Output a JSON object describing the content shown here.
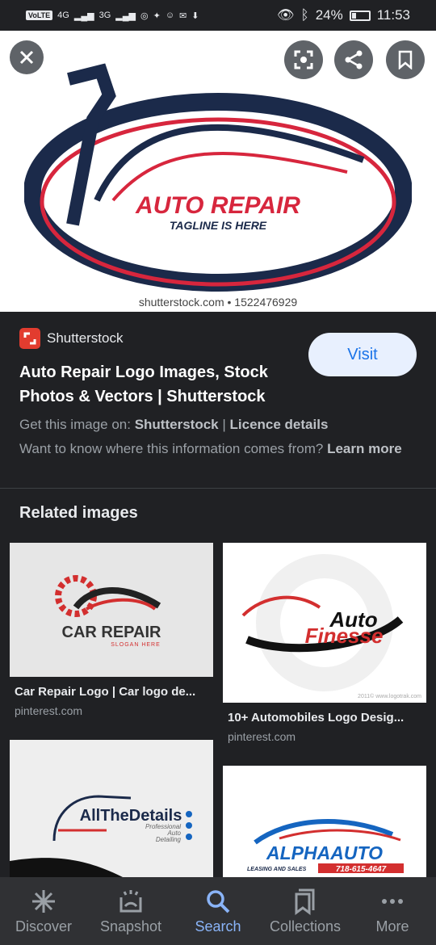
{
  "status_bar": {
    "carrier_badge": "VoLTE",
    "network_1": "4G",
    "network_2": "3G",
    "battery": "24%",
    "battery_level": 0.24,
    "time": "11:53"
  },
  "hero": {
    "logo_text": "AUTO REPAIR",
    "logo_tagline": "TAGLINE IS HERE",
    "credit": "shutterstock.com • 1522476929"
  },
  "info": {
    "source_name": "Shutterstock",
    "title": "Auto Repair Logo Images, Stock Photos & Vectors | Shutterstock",
    "visit_label": "Visit",
    "get_image_prefix": "Get this image on:",
    "get_image_source": "Shutterstock",
    "separator": "|",
    "licence_label": "Licence details",
    "want_to_know": "Want to know where this information comes from?",
    "learn_more": "Learn more"
  },
  "related": {
    "heading": "Related images",
    "items": [
      {
        "caption": "Car Repair Logo | Car logo de...",
        "source": "pinterest.com",
        "logo_text": "CAR REPAIR",
        "logo_sub": "SLOGAN HERE"
      },
      {
        "caption": "10+ Automobiles Logo Desig...",
        "source": "pinterest.com",
        "logo_text_1": "Auto",
        "logo_text_2": "Finesse",
        "watermark": "2011© www.logotrak.com"
      },
      {
        "logo_text": "AllTheDetails",
        "logo_sub_1": "Professional",
        "logo_sub_2": "Auto",
        "logo_sub_3": "Detailing"
      },
      {
        "logo_text": "ALPHAAUTO",
        "logo_sub": "LEASING AND SALES",
        "phone": "718-615-4647"
      }
    ]
  },
  "nav": {
    "items": [
      {
        "label": "Discover",
        "icon": "asterisk-icon"
      },
      {
        "label": "Snapshot",
        "icon": "snapshot-icon"
      },
      {
        "label": "Search",
        "icon": "search-icon"
      },
      {
        "label": "Collections",
        "icon": "collections-icon"
      },
      {
        "label": "More",
        "icon": "more-dots-icon"
      }
    ],
    "active": "Search"
  },
  "colors": {
    "background": "#202124",
    "accent": "#8ab4f8",
    "visit_bg": "#e8f0fe",
    "brand_red": "#e23c2f",
    "logo_navy": "#1b2a4a"
  }
}
